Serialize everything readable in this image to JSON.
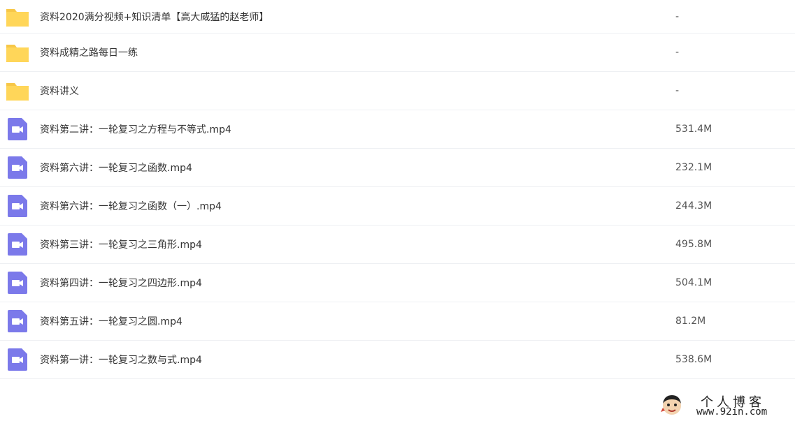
{
  "colors": {
    "folder": "#FFD659",
    "folder_tab": "#F7C748",
    "video": "#7B79EA",
    "divider": "#EEF0F3"
  },
  "files": [
    {
      "type": "folder",
      "icon": "folder-icon",
      "name": "资料2020满分视频+知识清单【高大威猛的赵老师】",
      "size": "-"
    },
    {
      "type": "folder",
      "icon": "folder-icon",
      "name": "资料成精之路每日一练",
      "size": "-"
    },
    {
      "type": "folder",
      "icon": "folder-icon",
      "name": "资料讲义",
      "size": "-"
    },
    {
      "type": "video",
      "icon": "video-file-icon",
      "name": "资料第二讲：一轮复习之方程与不等式.mp4",
      "size": "531.4M"
    },
    {
      "type": "video",
      "icon": "video-file-icon",
      "name": "资料第六讲：一轮复习之函数.mp4",
      "size": "232.1M"
    },
    {
      "type": "video",
      "icon": "video-file-icon",
      "name": "资料第六讲：一轮复习之函数（一）.mp4",
      "size": "244.3M"
    },
    {
      "type": "video",
      "icon": "video-file-icon",
      "name": "资料第三讲：一轮复习之三角形.mp4",
      "size": "495.8M"
    },
    {
      "type": "video",
      "icon": "video-file-icon",
      "name": "资料第四讲：一轮复习之四边形.mp4",
      "size": "504.1M"
    },
    {
      "type": "video",
      "icon": "video-file-icon",
      "name": "资料第五讲：一轮复习之圆.mp4",
      "size": "81.2M"
    },
    {
      "type": "video",
      "icon": "video-file-icon",
      "name": "资料第一讲：一轮复习之数与式.mp4",
      "size": "538.6M"
    }
  ],
  "watermark": {
    "title": "个人博客",
    "url": "www.92in.com"
  }
}
